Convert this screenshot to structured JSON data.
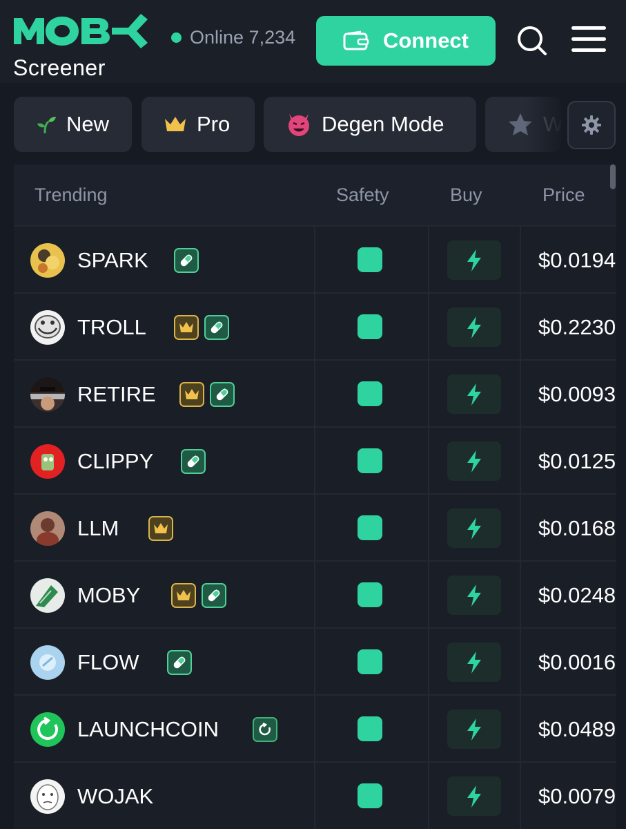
{
  "header": {
    "logo_text": "MOBY",
    "logo_sub": "Screener",
    "online_label": "Online 7,234",
    "connect_label": "Connect",
    "icons": {
      "search": "search-icon",
      "menu": "menu-icon",
      "wallet": "wallet-icon"
    },
    "accent_color": "#2ed3a0"
  },
  "filters": {
    "chips": [
      {
        "label": "New",
        "icon": "sprout-icon"
      },
      {
        "label": "Pro",
        "icon": "crown-icon"
      },
      {
        "label": "Degen Mode",
        "icon": "devil-icon"
      },
      {
        "label": "W",
        "icon": "star-icon"
      }
    ],
    "settings_icon": "gear-icon"
  },
  "table": {
    "columns": [
      "Trending",
      "Safety",
      "Buy",
      "Price"
    ],
    "rows": [
      {
        "name": "SPARK",
        "badges": [
          "pill"
        ],
        "price": "$0.0194"
      },
      {
        "name": "TROLL",
        "badges": [
          "crown",
          "pill"
        ],
        "price": "$0.2230"
      },
      {
        "name": "RETIRE",
        "badges": [
          "crown",
          "pill"
        ],
        "price": "$0.0093"
      },
      {
        "name": "CLIPPY",
        "badges": [
          "pill"
        ],
        "price": "$0.0125"
      },
      {
        "name": "LLM",
        "badges": [
          "crown"
        ],
        "price": "$0.0168"
      },
      {
        "name": "MOBY",
        "badges": [
          "crown",
          "pill"
        ],
        "price": "$0.0248"
      },
      {
        "name": "FLOW",
        "badges": [
          "pill"
        ],
        "price": "$0.0016"
      },
      {
        "name": "LAUNCHCOIN",
        "badges": [
          "launch"
        ],
        "price": "$0.0489"
      },
      {
        "name": "WOJAK",
        "badges": [],
        "price": "$0.0079"
      }
    ],
    "safety_color": "#2ed3a0",
    "buy_icon": "lightning-icon"
  }
}
